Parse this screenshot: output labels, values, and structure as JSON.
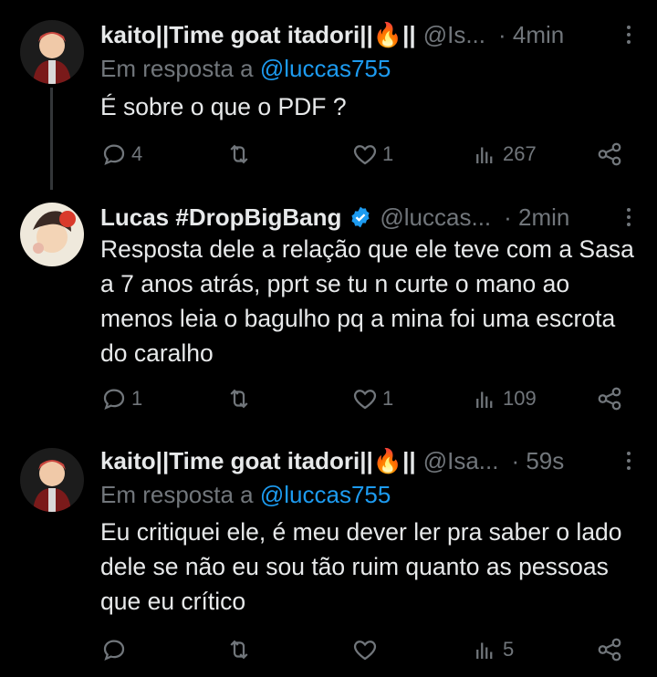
{
  "tweets": [
    {
      "name": "kaito||Time goat itadori||🔥||",
      "handle": "@Is...",
      "time": "· 4min",
      "reply_prefix": "Em resposta a",
      "reply_to": "@luccas755",
      "text": "É sobre o que o PDF ?",
      "stats": {
        "replies": "4",
        "retweets": "",
        "likes": "1",
        "views": "267"
      }
    },
    {
      "name": "Lucas #DropBigBang",
      "handle": "@luccas...",
      "time": "· 2min",
      "verified": true,
      "text": "Resposta dele a relação que ele teve com a Sasa a 7 anos atrás, pprt se tu n curte o mano ao menos leia o bagulho pq a mina foi uma escrota do caralho",
      "stats": {
        "replies": "1",
        "retweets": "",
        "likes": "1",
        "views": "109"
      }
    },
    {
      "name": "kaito||Time goat itadori||🔥||",
      "handle": "@Isa...",
      "time": "· 59s",
      "reply_prefix": "Em resposta a",
      "reply_to": "@luccas755",
      "text": "Eu critiquei ele, é meu dever ler pra saber o lado dele se não eu sou tão ruim quanto as pessoas que eu crítico",
      "stats": {
        "replies": "",
        "retweets": "",
        "likes": "",
        "views": "5"
      }
    }
  ],
  "colors": {
    "background": "#000000",
    "text": "#e7e9ea",
    "muted": "#71767b",
    "link": "#1d9bf0",
    "verified": "#1d9bf0"
  },
  "icons": [
    "reply-icon",
    "retweet-icon",
    "like-icon",
    "views-icon",
    "share-icon",
    "more-icon",
    "verified-icon"
  ]
}
